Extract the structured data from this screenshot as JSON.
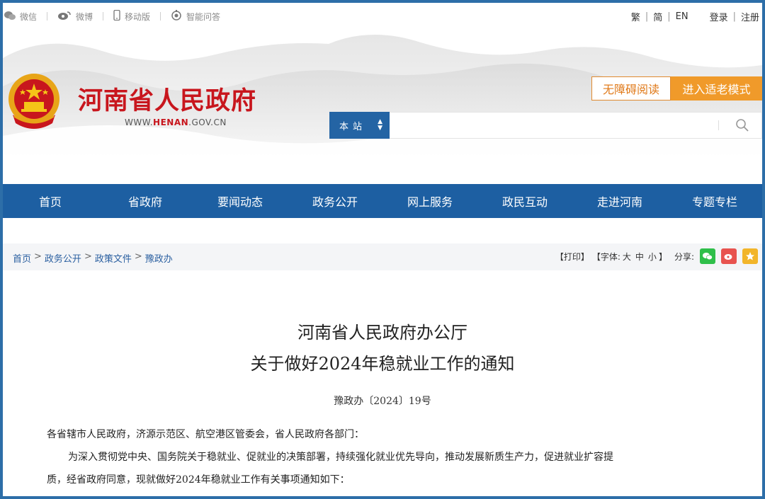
{
  "topbar": {
    "wechat": "微信",
    "weibo": "微博",
    "mobile": "移动版",
    "qa": "智能问答",
    "lang_trad": "繁",
    "lang_simp": "简",
    "lang_en": "EN",
    "login": "登录",
    "register": "注册"
  },
  "header": {
    "title": "河南省人民政府",
    "url_prefix": "WWW.",
    "url_domain": "HENAN",
    "url_suffix": ".GOV.CN",
    "accessible_label": "无障碍阅读",
    "elder_label": "进入适老模式"
  },
  "search": {
    "scope": "本站",
    "placeholder": ""
  },
  "nav": [
    "首页",
    "省政府",
    "要闻动态",
    "政务公开",
    "网上服务",
    "政民互动",
    "走进河南",
    "专题专栏"
  ],
  "breadcrumb": [
    "首页",
    "政务公开",
    "政策文件",
    "豫政办"
  ],
  "tools": {
    "print": "【打印】",
    "font_label": "【字体:",
    "font_large": "大",
    "font_medium": "中",
    "font_small": "小",
    "font_close": "】",
    "share": "分享:"
  },
  "article": {
    "title_line1": "河南省人民政府办公厅",
    "title_line2": "关于做好2024年稳就业工作的通知",
    "doc_number": "豫政办〔2024〕19号",
    "salutation": "各省辖市人民政府，济源示范区、航空港区管委会，省人民政府各部门：",
    "body_line1": "为深入贯彻党中央、国务院关于稳就业、促就业的决策部署，持续强化就业优先导向，推动发展新质生产力，促进就业扩容提",
    "body_line2": "质，经省政府同意，现就做好2024年稳就业工作有关事项通知如下："
  },
  "colors": {
    "nav_blue": "#1d5fa2",
    "title_red": "#c8161d",
    "elder_orange": "#f09a2a",
    "link_blue": "#2a5fa0"
  }
}
